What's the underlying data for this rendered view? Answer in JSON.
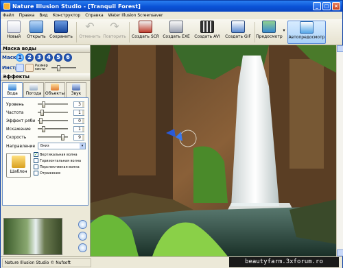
{
  "window": {
    "title": "Nature Illusion Studio - [Tranquil Forest]"
  },
  "menu": [
    "Файл",
    "Правка",
    "Вид",
    "Конструктор",
    "Справка",
    "Water Illusion Screensaver"
  ],
  "toolbar": {
    "new": "Новый",
    "open": "Открыть",
    "save": "Сохранить",
    "undo": "Отменить",
    "redo": "Повторить",
    "scr": "Создать SCR",
    "exe": "Создать EXE",
    "avi": "Создать AVI",
    "gif": "Создать GIF",
    "preview": "Предосмотр",
    "autopreview": "Автопредосмотр"
  },
  "mask": {
    "title": "Маска воды",
    "label": "Маска",
    "instr_label": "Инстр.",
    "brush_size": "Размер кисти",
    "numbers": [
      "1",
      "2",
      "3",
      "4",
      "5",
      "6"
    ]
  },
  "effects": {
    "title": "Эффекты",
    "tabs": [
      "Вода",
      "Погода",
      "Объекты",
      "Звук"
    ],
    "params": [
      {
        "label": "Уровень",
        "value": "3",
        "level": 0.15
      },
      {
        "label": "Частота",
        "value": "1",
        "level": 0.1
      },
      {
        "label": "Эффект ряби",
        "value": "0",
        "level": 0.05
      },
      {
        "label": "Искажение",
        "value": "1",
        "level": 0.15
      },
      {
        "label": "Скорость",
        "value": "9",
        "level": 0.9
      }
    ],
    "direction_label": "Направление",
    "direction_value": "Вниз",
    "template": "Шаблон",
    "checks": [
      {
        "label": "Вертикальная волна",
        "checked": true
      },
      {
        "label": "Горизонтальная волна",
        "checked": false
      },
      {
        "label": "Перспективная волна",
        "checked": false
      },
      {
        "label": "Отражение",
        "checked": false
      }
    ]
  },
  "status": {
    "left": "Nature Illusion Studio © Nufsoft"
  },
  "watermark": "beautyfarm.3xforum.ro"
}
